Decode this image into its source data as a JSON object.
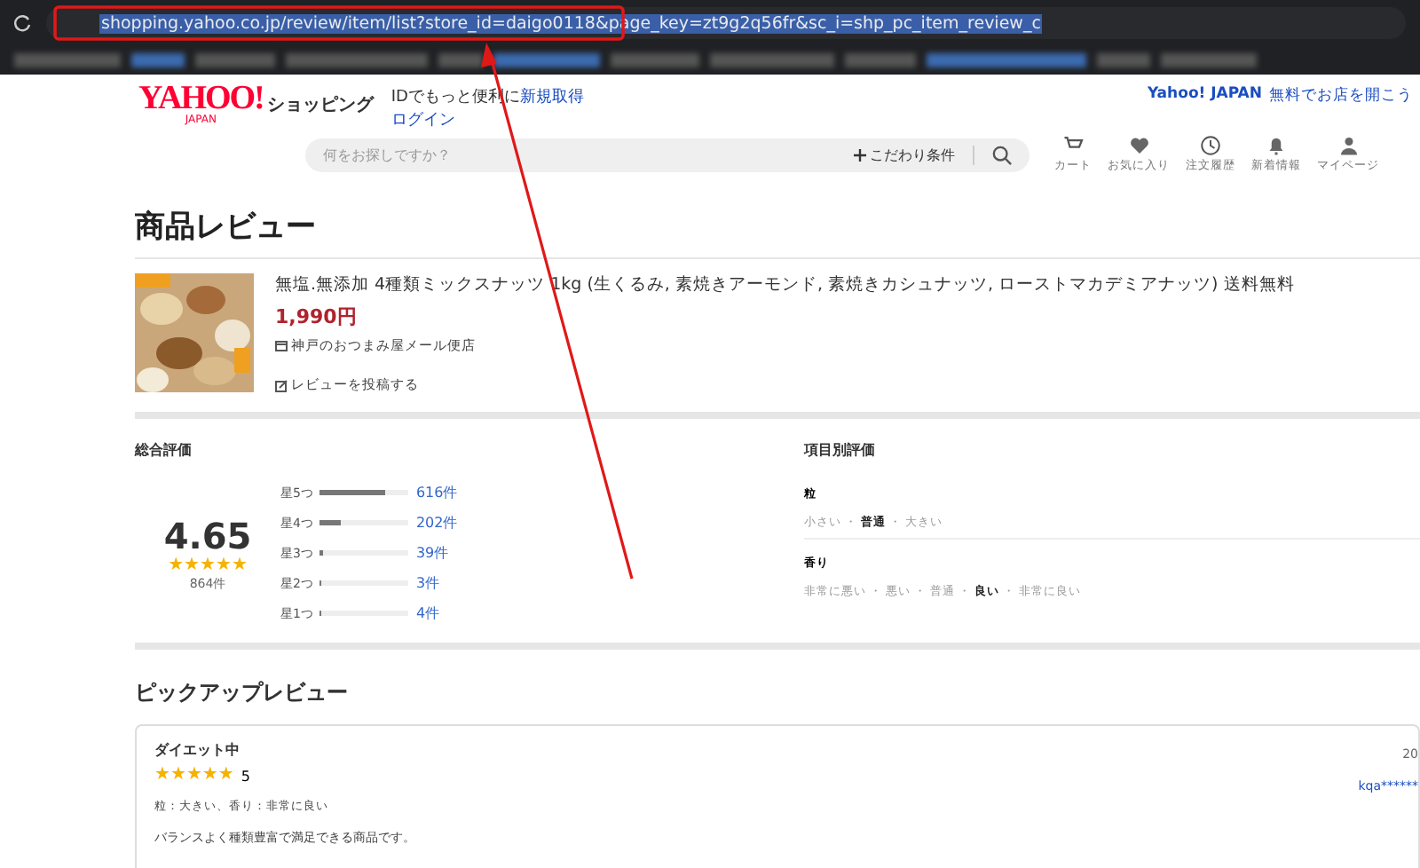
{
  "browser": {
    "url": "shopping.yahoo.co.jp/review/item/list?store_id=daigo0118&page_key=zt9g2q56fr&sc_i=shp_pc_item_review_c"
  },
  "header": {
    "logo": "YAHOO!",
    "logo_sub": "JAPAN",
    "service": "ショッピング",
    "promo": "IDでもっと便利に",
    "promo_link": "新規取得",
    "login": "ログイン",
    "top_link": "Yahoo! JAPAN",
    "store_link": "無料でお店を開こう",
    "search_placeholder": "何をお探しですか？",
    "filter": "こだわり条件",
    "nav": [
      {
        "kind": "cart",
        "label": "カート"
      },
      {
        "kind": "heart",
        "label": "お気に入り"
      },
      {
        "kind": "history",
        "label": "注文履歴"
      },
      {
        "kind": "bell",
        "label": "新着情報"
      },
      {
        "kind": "user",
        "label": "マイページ"
      }
    ]
  },
  "page_title": "商品レビュー",
  "product": {
    "name": "無塩.無添加 4種類ミックスナッツ 1kg (生くるみ, 素焼きアーモンド, 素焼きカシュナッツ, ローストマカデミアナッツ) 送料無料",
    "price": "1,990円",
    "store": "神戸のおつまみ屋メール便店",
    "write_review": "レビューを投稿する"
  },
  "overall": {
    "title": "総合評価",
    "score": "4.65",
    "stars": 5,
    "count": "864件",
    "bars": [
      {
        "label": "星5つ",
        "level": 0.73,
        "count": "616件"
      },
      {
        "label": "星4つ",
        "level": 0.24,
        "count": "202件"
      },
      {
        "label": "星3つ",
        "level": 0.03,
        "count": "39件"
      },
      {
        "label": "星2つ",
        "level": 0.01,
        "count": "3件"
      },
      {
        "label": "星1つ",
        "level": 0.01,
        "count": "4件"
      }
    ]
  },
  "item_ratings": {
    "title": "項目別評価",
    "separator": "・",
    "items": [
      {
        "name": "粒",
        "options": [
          {
            "label": "小さい",
            "selected": false
          },
          {
            "label": "普通",
            "selected": true
          },
          {
            "label": "大きい",
            "selected": false
          }
        ]
      },
      {
        "name": "香り",
        "options": [
          {
            "label": "非常に悪い",
            "selected": false
          },
          {
            "label": "悪い",
            "selected": false
          },
          {
            "label": "普通",
            "selected": false
          },
          {
            "label": "良い",
            "selected": true
          },
          {
            "label": "非常に良い",
            "selected": false
          }
        ]
      }
    ]
  },
  "pickup": {
    "title": "ピックアップレビュー",
    "reviews": [
      {
        "title": "ダイエット中",
        "stars": 5,
        "score": "5",
        "date": "20",
        "user": "kqa******",
        "attributes": "粒：大きい、香り：非常に良い",
        "body": "バランスよく種類豊富で満足できる商品です。"
      }
    ]
  }
}
